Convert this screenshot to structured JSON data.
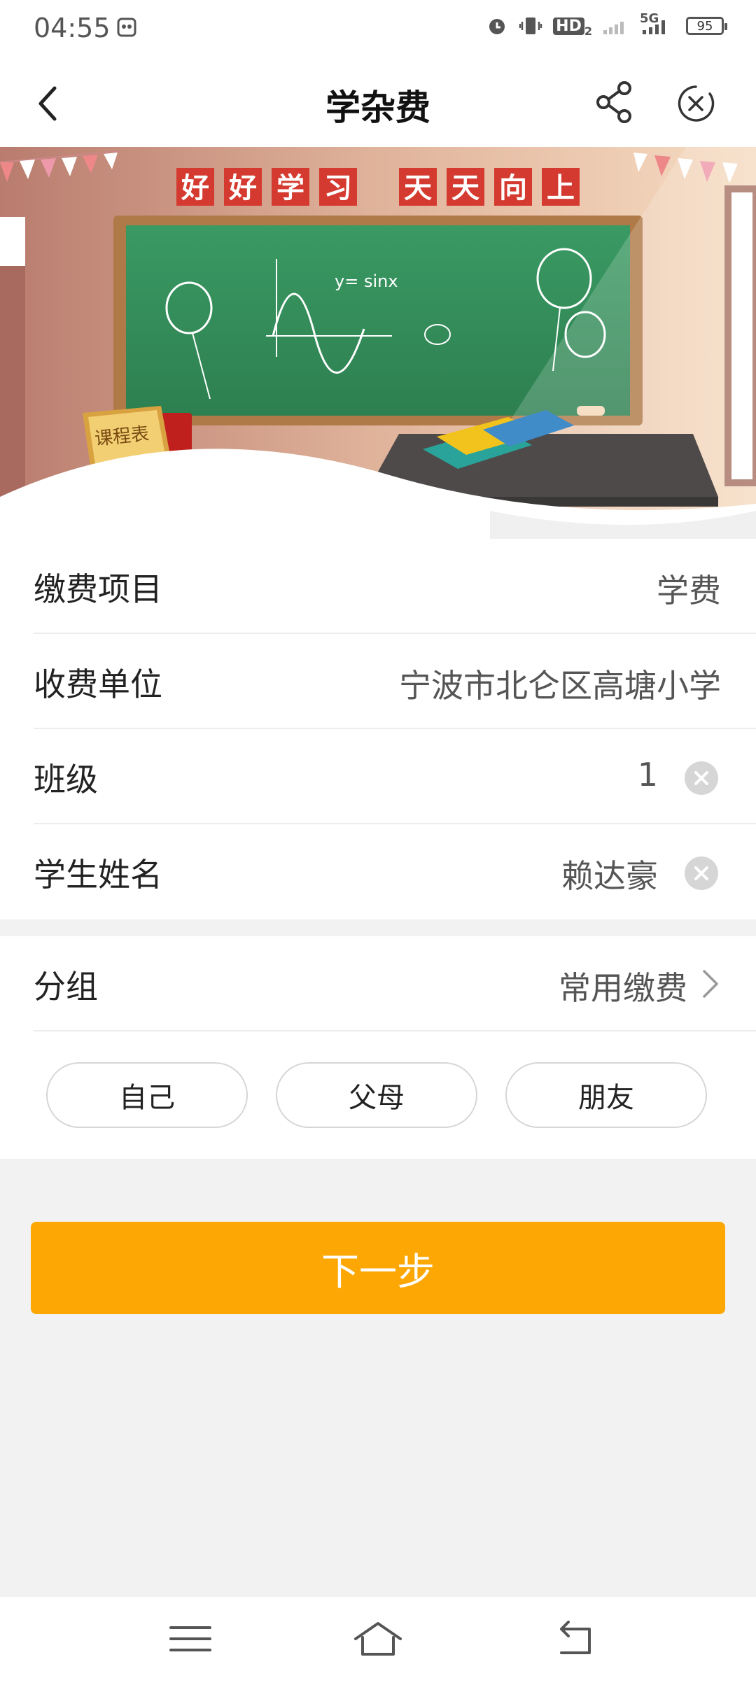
{
  "status_bar": {
    "time": "04:55",
    "signal_label": "5G",
    "hd_label": "HD",
    "hd_sub": "2",
    "battery": "95"
  },
  "header": {
    "title": "学杂费",
    "back_icon": "chevron-left-icon",
    "share_icon": "share-icon",
    "close_icon": "close-circle-icon"
  },
  "banner": {
    "slogan_left": [
      "好",
      "好",
      "学",
      "习"
    ],
    "slogan_right": [
      "天",
      "天",
      "向",
      "上"
    ],
    "board_formula": "y= sinx",
    "schedule_sign": "课程表"
  },
  "form": {
    "rows": [
      {
        "label": "缴费项目",
        "value": "学费",
        "clearable": false
      },
      {
        "label": "收费单位",
        "value": "宁波市北仑区高塘小学",
        "clearable": false
      },
      {
        "label": "班级",
        "value": "1",
        "clearable": true
      },
      {
        "label": "学生姓名",
        "value": "赖达豪",
        "clearable": true
      }
    ]
  },
  "group": {
    "label": "分组",
    "value": "常用缴费",
    "chips": [
      "自己",
      "父母",
      "朋友"
    ]
  },
  "next_button": "下一步",
  "colors": {
    "accent": "#fca703",
    "board": "#2e8b57",
    "banner_red": "#d43a2f"
  }
}
